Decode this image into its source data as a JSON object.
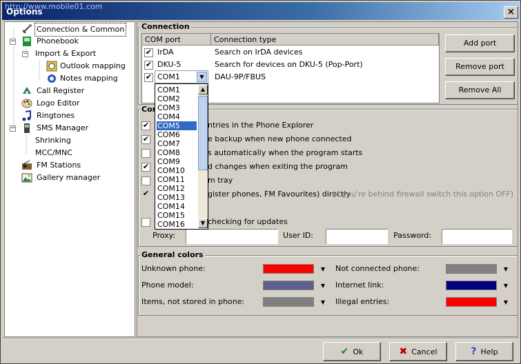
{
  "window": {
    "title": "Options",
    "watermark": "http://www.mobile01.com",
    "close": "×"
  },
  "tree": {
    "items": [
      {
        "label": "Connection & Common",
        "icon": "connection-icon"
      },
      {
        "label": "Phonebook",
        "icon": "phonebook-icon"
      },
      {
        "label": "Import & Export",
        "icon": "import-export-icon"
      },
      {
        "label": "Outlook mapping",
        "icon": "outlook-icon"
      },
      {
        "label": "Notes mapping",
        "icon": "notes-icon"
      },
      {
        "label": "Call Register",
        "icon": "call-register-icon"
      },
      {
        "label": "Logo Editor",
        "icon": "logo-editor-icon"
      },
      {
        "label": "Ringtones",
        "icon": "ringtones-icon"
      },
      {
        "label": "SMS Manager",
        "icon": "sms-icon"
      },
      {
        "label": "Shrinking",
        "icon": ""
      },
      {
        "label": "MCC/MNC",
        "icon": ""
      },
      {
        "label": "FM Stations",
        "icon": "radio-icon"
      },
      {
        "label": "Gallery manager",
        "icon": "gallery-icon"
      }
    ]
  },
  "connection": {
    "title": "Connection",
    "headers": {
      "port": "COM port",
      "type": "Connection type"
    },
    "rows": [
      {
        "port": "IrDA",
        "type": "Search on IrDA devices",
        "checked": true
      },
      {
        "port": "DKU-5",
        "type": "Search for devices on DKU-5 (Pop-Port)",
        "checked": true
      },
      {
        "port": "COM1",
        "type": "DAU-9P/FBUS",
        "checked": true
      }
    ],
    "buttons": {
      "add": "Add port",
      "remove": "Remove port",
      "remove_all": "Remove All"
    }
  },
  "dropdown": {
    "selected": "COM5",
    "options": [
      "COM1",
      "COM2",
      "COM3",
      "COM4",
      "COM5",
      "COM6",
      "COM7",
      "COM8",
      "COM9",
      "COM10",
      "COM11",
      "COM12",
      "COM13",
      "COM14",
      "COM15",
      "COM16"
    ]
  },
  "common": {
    "title": "Com",
    "options": [
      {
        "label": "ntries in the Phone Explorer",
        "checked": true
      },
      {
        "label": "e backup when new phone connected",
        "checked": true
      },
      {
        "label": "s automatically when the program starts",
        "checked": false
      },
      {
        "label": "d changes when exiting the program",
        "checked": true
      },
      {
        "label": "m tray",
        "checked": false
      },
      {
        "label": "gister phones, FM Favourites) directly",
        "hint": "(if you're behind firewall switch this option OFF)",
        "checked": true
      },
      {
        "label": "checking for updates",
        "checked": false
      }
    ],
    "proxy_label": "Proxy:",
    "userid_label": "User ID:",
    "password_label": "Password:",
    "proxy_value": "",
    "userid_value": "",
    "password_value": ""
  },
  "colors": {
    "title": "General colors",
    "items": [
      {
        "label": "Unknown phone:",
        "color": "#ff0000"
      },
      {
        "label": "Phone model:",
        "color": "#5f5f8f"
      },
      {
        "label": "Items, not stored in phone:",
        "color": "#808080"
      },
      {
        "label": "Not connected phone:",
        "color": "#808080"
      },
      {
        "label": "Internet link:",
        "color": "#000080"
      },
      {
        "label": "Illegal entries:",
        "color": "#ff0000"
      }
    ]
  },
  "footer": {
    "ok": "Ok",
    "cancel": "Cancel",
    "help": "Help"
  }
}
